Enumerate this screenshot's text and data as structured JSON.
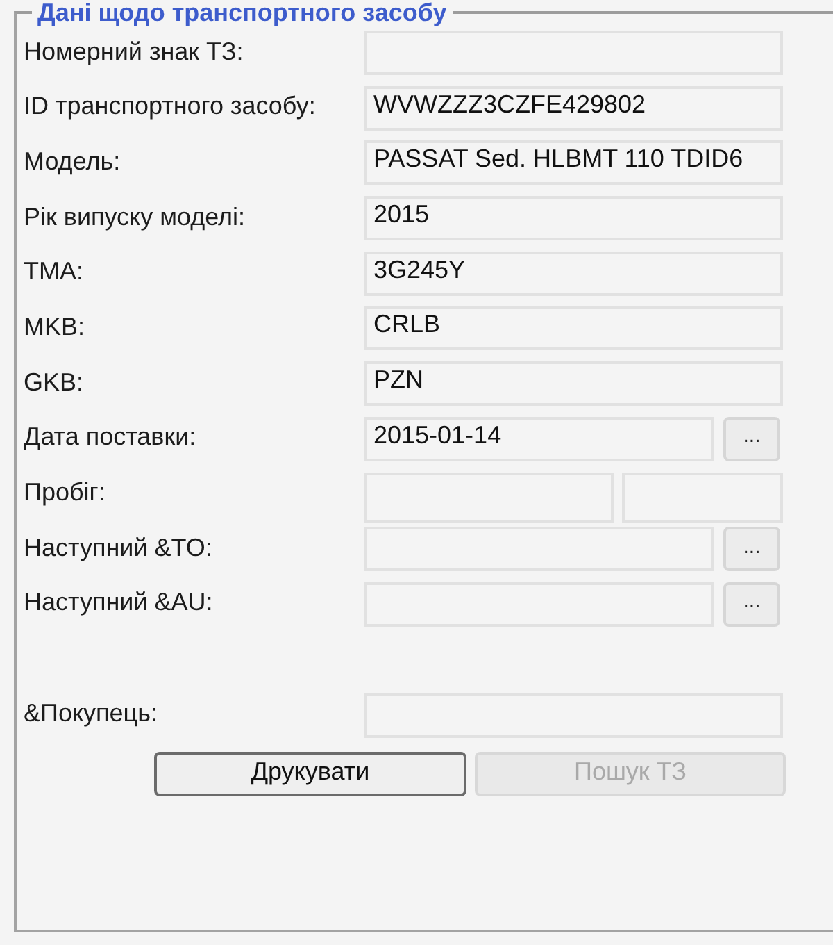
{
  "group": {
    "title": "Дані щодо транспортного засобу"
  },
  "fields": [
    {
      "label": "Номерний знак ТЗ:",
      "kind": "text"
    },
    {
      "label": "ID транспортного засобу:",
      "kind": "text",
      "value": "WVWZZZ3CZFE429802"
    },
    {
      "label": "Модель:",
      "kind": "text",
      "value": "PASSAT Sed. HLBMT 110 TDID6"
    },
    {
      "label": "Рік випуску моделі:",
      "kind": "text",
      "value": "2015"
    },
    {
      "label": "TMA:",
      "kind": "text",
      "value": "3G245Y"
    },
    {
      "label": "MKB:",
      "kind": "text",
      "value": "CRLB"
    },
    {
      "label": "GKB:",
      "kind": "text",
      "value": "PZN"
    },
    {
      "label": "Дата поставки:",
      "kind": "picker",
      "value": "2015-01-14",
      "button": "..."
    },
    {
      "label": "Пробіг:",
      "kind": "pair"
    },
    {
      "label": "Наступний &TO:",
      "kind": "picker",
      "button": "..."
    },
    {
      "label": "Наступний &AU:",
      "kind": "picker",
      "button": "..."
    }
  ],
  "buyer": {
    "label": "&Покупець:"
  },
  "buttons": [
    {
      "label": "Друкувати",
      "disabled": false,
      "default": true
    },
    {
      "label": "Пошук ТЗ",
      "disabled": true,
      "default": false
    }
  ]
}
